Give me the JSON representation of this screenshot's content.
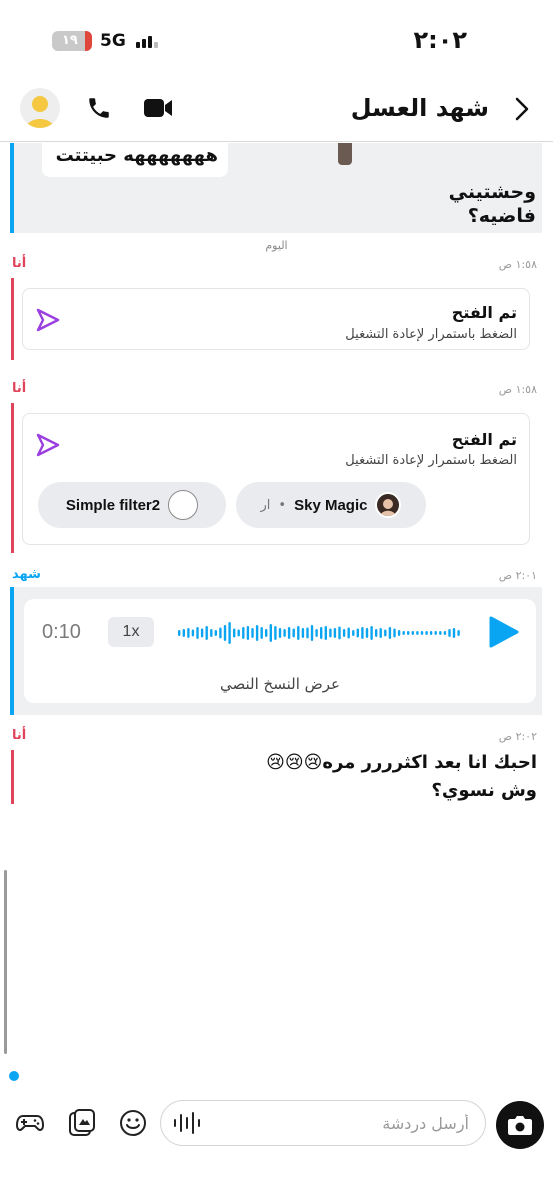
{
  "status_bar": {
    "time": "٢:٠٢",
    "battery": "١٩",
    "network": "5G"
  },
  "header": {
    "title": "شهد العسل"
  },
  "previous": {
    "bubble_text": "هههههههه حبيتتت",
    "line1": "وحشتيني",
    "line2": "فاضيه؟"
  },
  "day_label": "اليوم",
  "messages": [
    {
      "sender": "أنا",
      "time": "١:٥٨ ص",
      "title": "تم الفتح",
      "subtitle": "الضغط باستمرار لإعادة التشغيل"
    },
    {
      "sender": "أنا",
      "time": "١:٥٨ ص",
      "title": "تم الفتح",
      "subtitle": "الضغط باستمرار لإعادة التشغيل",
      "filters": [
        {
          "name": "Simple filter2"
        },
        {
          "name": "Sky Magic",
          "extra": "ار"
        }
      ]
    },
    {
      "sender": "شهد",
      "time": "٢:٠١ ص",
      "voice": {
        "duration": "0:10",
        "speed": "1x",
        "transcript": "عرض النسخ النصي",
        "color": "#0aa5f2"
      }
    },
    {
      "sender": "أنا",
      "time": "٢:٠٢ ص",
      "text_line1": "احبك انا بعد اكثرررر مره😢😢😢",
      "text_line2": "وش نسوي؟"
    }
  ],
  "composer": {
    "placeholder": "أرسل دردشة"
  },
  "colors": {
    "me": "#e0445a",
    "her": "#0aa5f2",
    "snap_arrow": "#9b3fe0"
  },
  "icons": [
    "gamepad-icon",
    "sticker-icon",
    "smiley-icon",
    "waveform-icon",
    "camera-icon",
    "phone-icon",
    "video-icon",
    "chevron-right-icon"
  ]
}
